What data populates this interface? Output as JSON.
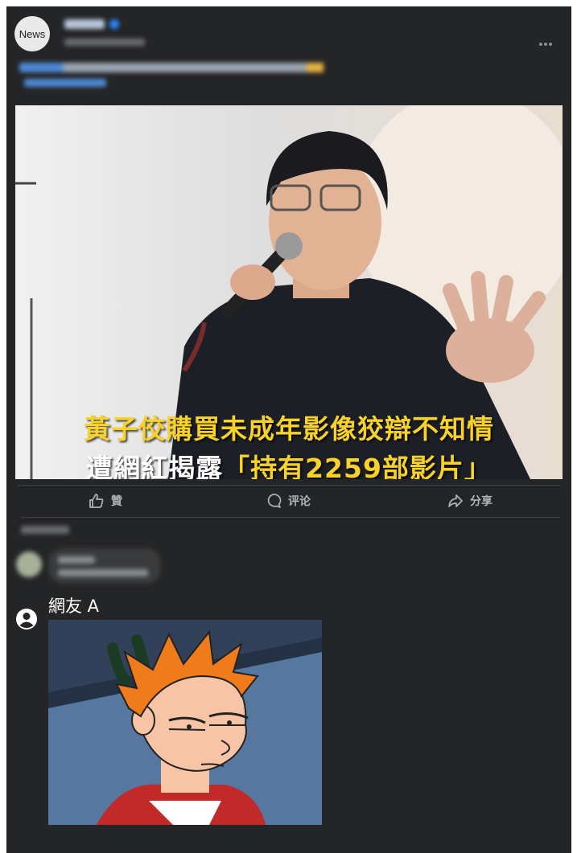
{
  "post": {
    "avatar_text": "News",
    "image_headline_line1": "黃子佼購買未成年影像狡辯不知情",
    "image_headline_line2_prefix": "遭網紅揭露",
    "image_headline_line2_quote": "「持有2259部影片」"
  },
  "actions": [
    {
      "label": "贊",
      "icon": "thumbs-up-icon"
    },
    {
      "label": "评论",
      "icon": "comment-icon"
    },
    {
      "label": "分享",
      "icon": "share-icon"
    }
  ],
  "reply": {
    "user_name": "網友 A",
    "user_icon": "user-circle-icon"
  },
  "colors": {
    "background": "#242526",
    "headline_yellow": "#f8d22a",
    "action_text": "#b0b3b8"
  }
}
